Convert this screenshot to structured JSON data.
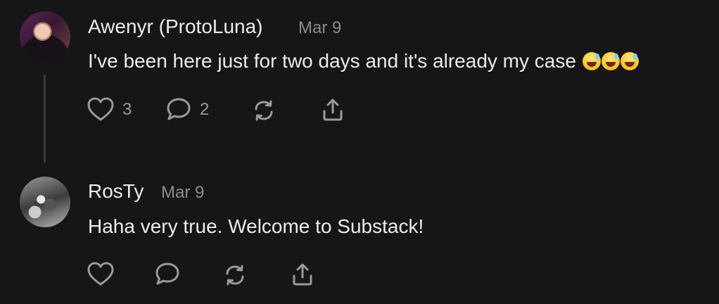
{
  "comments": [
    {
      "author": "Awenyr (ProtoLuna)",
      "date": "Mar 9",
      "text": "I've been here just for two days and it's already my case",
      "emoji": "😅😅😅",
      "likes": "3",
      "replies": "2"
    },
    {
      "author": "RosTy",
      "date": "Mar 9",
      "text": "Haha very true. Welcome to Substack!"
    }
  ],
  "icons": {
    "like": "heart-icon",
    "reply": "speech-bubble-icon",
    "restack": "restack-icon",
    "share": "share-icon"
  },
  "colors": {
    "background": "#161618",
    "text": "#ececec",
    "muted": "#8c8c8c",
    "thread_line": "#3a3a3c"
  }
}
